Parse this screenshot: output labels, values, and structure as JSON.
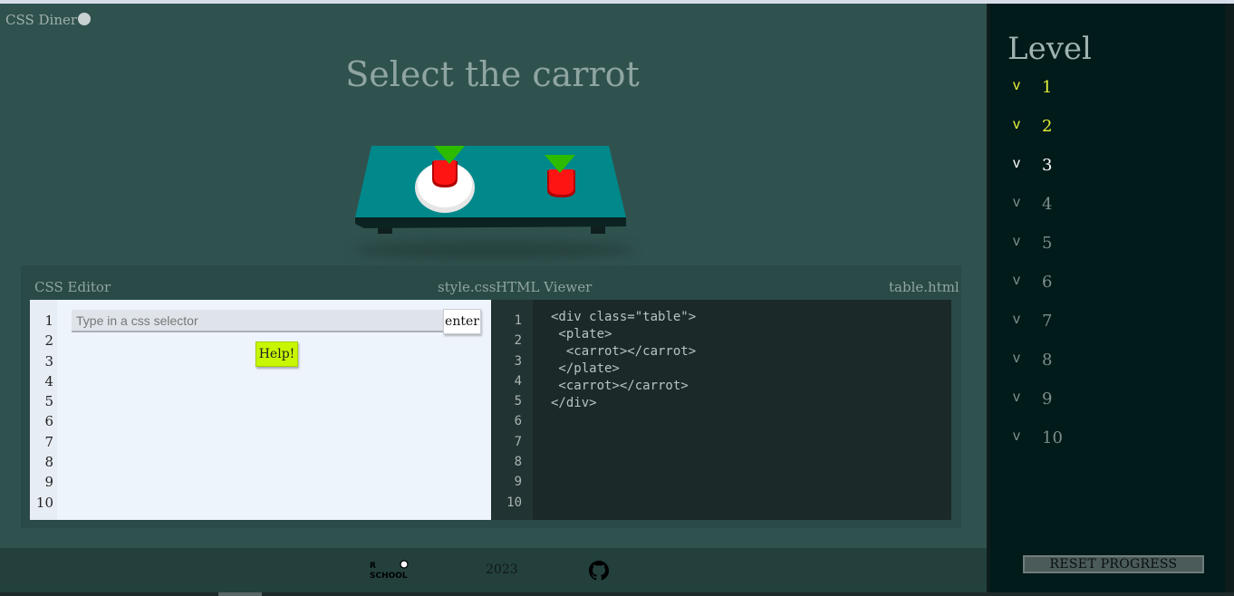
{
  "app": {
    "brand": "CSS Diner"
  },
  "instruction": "Select the carrot",
  "scene": {
    "colors": {
      "table": "#00888a",
      "table_side": "#006c6e",
      "plate": "#ffffff",
      "carrot": "#ff1a1a",
      "leaf": "#2dbb00"
    }
  },
  "editor": {
    "title": "CSS Editor",
    "filename": "style.css",
    "placeholder": "Type in a css selector",
    "enter_label": "enter",
    "help_label": "Help!",
    "line_numbers": [
      "1",
      "2",
      "3",
      "4",
      "5",
      "6",
      "7",
      "8",
      "9",
      "10"
    ]
  },
  "viewer": {
    "title": "HTML Viewer",
    "filename": "table.html",
    "line_numbers": [
      "1",
      "2",
      "3",
      "4",
      "5",
      "6",
      "7",
      "8",
      "9",
      "10"
    ],
    "code_lines": [
      "<div class=\"table\">",
      " <plate>",
      "  <carrot></carrot>",
      " </plate>",
      " <carrot></carrot>",
      "</div>"
    ]
  },
  "footer": {
    "year": "2023",
    "logo_text": "RS SCHOOL",
    "github_icon": "github-icon"
  },
  "sidebar": {
    "title": "Level",
    "levels": [
      {
        "check": "v",
        "num": "1",
        "state": "done"
      },
      {
        "check": "v",
        "num": "2",
        "state": "done"
      },
      {
        "check": "v",
        "num": "3",
        "state": "current"
      },
      {
        "check": "v",
        "num": "4",
        "state": "todo"
      },
      {
        "check": "v",
        "num": "5",
        "state": "todo"
      },
      {
        "check": "v",
        "num": "6",
        "state": "todo"
      },
      {
        "check": "v",
        "num": "7",
        "state": "todo"
      },
      {
        "check": "v",
        "num": "8",
        "state": "todo"
      },
      {
        "check": "v",
        "num": "9",
        "state": "todo"
      },
      {
        "check": "v",
        "num": "10",
        "state": "todo"
      }
    ],
    "reset_label": "RESET PROGRESS"
  }
}
